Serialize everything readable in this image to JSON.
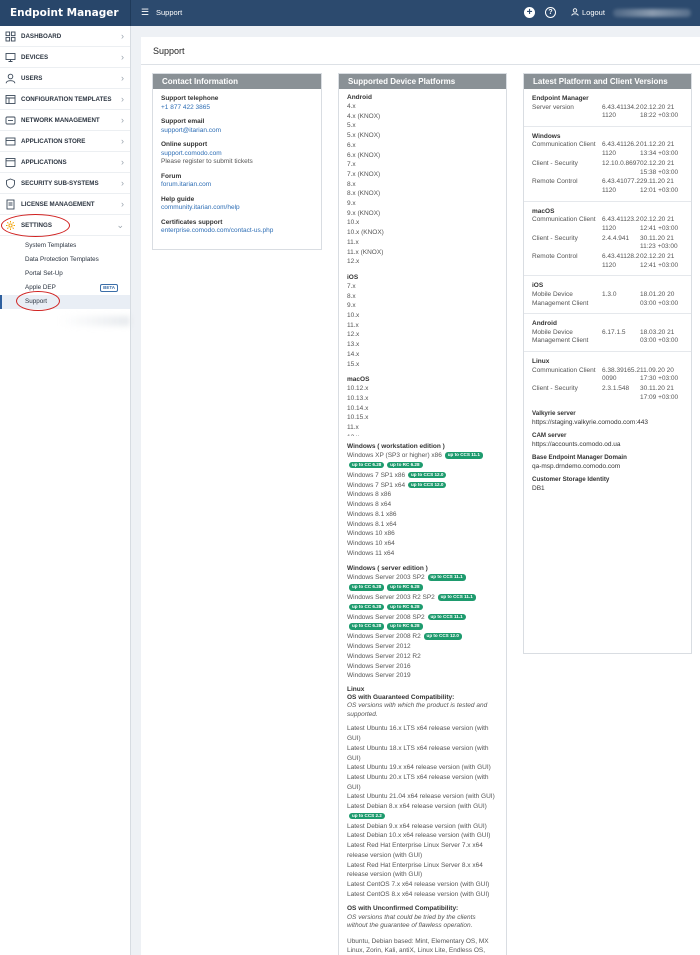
{
  "app": {
    "title": "Endpoint Manager"
  },
  "topbar": {
    "breadcrumb": "Support",
    "logout_label": "Logout"
  },
  "sidebar": {
    "items": [
      {
        "label": "DASHBOARD",
        "icon": "grid-icon"
      },
      {
        "label": "DEVICES",
        "icon": "devices-icon"
      },
      {
        "label": "USERS",
        "icon": "user-icon"
      },
      {
        "label": "CONFIGURATION TEMPLATES",
        "icon": "template-icon"
      },
      {
        "label": "NETWORK MANAGEMENT",
        "icon": "network-icon"
      },
      {
        "label": "APPLICATION STORE",
        "icon": "store-icon"
      },
      {
        "label": "APPLICATIONS",
        "icon": "applications-icon"
      },
      {
        "label": "SECURITY SUB-SYSTEMS",
        "icon": "shield-icon"
      },
      {
        "label": "LICENSE MANAGEMENT",
        "icon": "license-icon"
      },
      {
        "label": "SETTINGS",
        "icon": "gear-icon"
      }
    ],
    "settings_sub": [
      "System Templates",
      "Data Protection Templates",
      "Portal Set-Up",
      "Apple DEP",
      "Support"
    ],
    "beta_label": "BETA"
  },
  "page": {
    "title": "Support"
  },
  "contact": {
    "heading": "Contact Information",
    "telephone_label": "Support telephone",
    "telephone": "+1 877 422 3865",
    "email_label": "Support email",
    "email": "support@itarian.com",
    "online_label": "Online support",
    "online": "support.comodo.com",
    "online_note": "Please register to submit tickets",
    "forum_label": "Forum",
    "forum": "forum.itarian.com",
    "help_label": "Help guide",
    "help": "community.itarian.com/help",
    "cert_label": "Certificates support",
    "cert": "enterprise.comodo.com/contact-us.php"
  },
  "platforms": {
    "heading": "Supported Device Platforms",
    "android_label": "Android",
    "android": [
      "4.x",
      "4.x (KNOX)",
      "5.x",
      "5.x (KNOX)",
      "6.x",
      "6.x (KNOX)",
      "7.x",
      "7.x (KNOX)",
      "8.x",
      "8.x (KNOX)",
      "9.x",
      "9.x (KNOX)",
      "10.x",
      "10.x (KNOX)",
      "11.x",
      "11.x (KNOX)",
      "12.x"
    ],
    "ios_label": "iOS",
    "ios": [
      "7.x",
      "8.x",
      "9.x",
      "10.x",
      "11.x",
      "12.x",
      "13.x",
      "14.x",
      "15.x"
    ],
    "macos_label": "macOS",
    "macos": [
      "10.12.x",
      "10.13.x",
      "10.14.x",
      "10.15.x",
      "11.x",
      "12.x"
    ],
    "win_ws_label": "Windows ( workstation edition )",
    "win_ws": [
      {
        "name": "Windows XP (SP3 or higher) x86",
        "pills": [
          "up to CCS 11.1"
        ],
        "pills2": [
          "up to CC 6.28",
          "up to RC 6.28"
        ]
      },
      {
        "name": "Windows 7 SP1 x86",
        "pills": [
          "up to CCS 12.0"
        ]
      },
      {
        "name": "Windows 7 SP1 x64",
        "pills": [
          "up to CCS 12.0"
        ]
      },
      {
        "name": "Windows 8 x86"
      },
      {
        "name": "Windows 8 x64"
      },
      {
        "name": "Windows 8.1 x86"
      },
      {
        "name": "Windows 8.1 x64"
      },
      {
        "name": "Windows 10 x86"
      },
      {
        "name": "Windows 10 x64"
      },
      {
        "name": "Windows 11 x64"
      }
    ],
    "win_srv_label": "Windows ( server edition )",
    "win_srv": [
      {
        "name": "Windows Server 2003 SP2",
        "pills": [
          "up to CCS 11.1"
        ],
        "pills2": [
          "up to CC 6.28",
          "up to RC 6.28"
        ]
      },
      {
        "name": "Windows Server 2003 R2 SP2",
        "pills": [
          "up to CCS 11.1"
        ],
        "pills2": [
          "up to CC 6.28",
          "up to RC 6.28"
        ]
      },
      {
        "name": "Windows Server 2008 SP2",
        "pills": [
          "up to CCS 11.1"
        ],
        "pills2": [
          "up to CC 6.28",
          "up to RC 6.28"
        ]
      },
      {
        "name": "Windows Server 2008 R2",
        "pills": [
          "up to CCS 12.0"
        ]
      },
      {
        "name": "Windows Server 2012"
      },
      {
        "name": "Windows Server 2012 R2"
      },
      {
        "name": "Windows Server 2016"
      },
      {
        "name": "Windows Server 2019"
      }
    ],
    "linux_label": "Linux",
    "linux_guaranteed_label": "OS with Guaranteed Compatibility:",
    "linux_guaranteed_note": "OS versions with which the product is tested and supported.",
    "linux_guaranteed": [
      "Latest Ubuntu 16.x LTS x64 release version (with GUI)",
      "Latest Ubuntu 18.x LTS x64 release version (with GUI)",
      "Latest Ubuntu 19.x x64 release version (with GUI)",
      "Latest Ubuntu 20.x LTS x64 release version (with GUI)",
      "Latest Ubuntu 21.04 x64 release version (with GUI)",
      "Latest Debian 8.x x64 release version (with GUI)"
    ],
    "debian8_pill": "up to CCS 2.2",
    "linux_guaranteed_2": [
      "Latest Debian 9.x x64 release version (with GUI)",
      "Latest Debian 10.x x64 release version (with GUI)",
      "Latest Red Hat Enterprise Linux Server 7.x x64 release version (with GUI)",
      "Latest Red Hat Enterprise Linux Server 8.x x64 release version (with GUI)",
      "Latest CentOS 7.x x64 release version (with GUI)",
      "Latest CentOS 8.x x64 release version (with GUI)"
    ],
    "linux_unconfirmed_label": "OS with Unconfirmed Compatibility:",
    "linux_unconfirmed_note": "OS versions that could be tried by the clients without the guarantee of flawless operation.",
    "linux_unconfirmed": "Ubuntu, Debian based: Mint, Elementary OS, MX Linux, Zorin, Kali, antiX, Linux Lite, Endless OS, KDE neon, Lubuntu, Peppermint OS, Ubuntu MATE, deepin, SparkyLinux, Xubuntu, Tails, Devuan GNU+Linux, Q4OS, Parrot Security OS, LXLE, Kubuntu, Bodhi Linux, feren OS"
  },
  "versions": {
    "heading": "Latest Platform and Client Versions",
    "sections": [
      {
        "title": "Endpoint Manager",
        "rows": [
          {
            "k": "Server version",
            "v": "6.43.41134.2 1120",
            "d": "02.12.20 21 18:22 +03:00"
          }
        ]
      },
      {
        "title": "Windows",
        "rows": [
          {
            "k": "Communication Client",
            "v": "6.43.41126.2 1120",
            "d": "01.12.20 21 13:34 +03:00"
          },
          {
            "k": "Client - Security",
            "v": "12.10.0.8697",
            "d": "02.12.20 21 15:38 +03:00"
          },
          {
            "k": "Remote Control",
            "v": "6.43.41077.2 1120",
            "d": "29.11.20 21 12:01 +03:00"
          }
        ]
      },
      {
        "title": "macOS",
        "rows": [
          {
            "k": "Communication Client",
            "v": "6.43.41123.2 1120",
            "d": "02.12.20 21 12:41 +03:00"
          },
          {
            "k": "Client - Security",
            "v": "2.4.4.941",
            "d": "30.11.20 21 11:23 +03:00"
          },
          {
            "k": "Remote Control",
            "v": "6.43.41128.2 1120",
            "d": "02.12.20 21 12:41 +03:00"
          }
        ]
      },
      {
        "title": "iOS",
        "rows": [
          {
            "k": "Mobile Device Management Client",
            "v": "1.3.0",
            "d": "18.01.20 20 03:00 +03:00"
          }
        ]
      },
      {
        "title": "Android",
        "rows": [
          {
            "k": "Mobile Device Management Client",
            "v": "6.17.1.5",
            "d": "18.03.20 21 03:00 +03:00"
          }
        ]
      },
      {
        "title": "Linux",
        "rows": [
          {
            "k": "Communication Client",
            "v": "6.38.39165.2 0090",
            "d": "11.09.20 20 17:30 +03:00"
          },
          {
            "k": "Client - Security",
            "v": "2.3.1.548",
            "d": "30.11.20 21 17:09 +03:00"
          }
        ]
      }
    ],
    "valkyrie_label": "Valkyrie server",
    "valkyrie": "https://staging.valkyrie.comodo.com:443",
    "cam_label": "CAM server",
    "cam": "https://accounts.comodo.od.ua",
    "base_label": "Base Endpoint Manager Domain",
    "base": "qa-msp.drndemo.comodo.com",
    "storage_label": "Customer Storage Identity",
    "storage": "DB1"
  }
}
